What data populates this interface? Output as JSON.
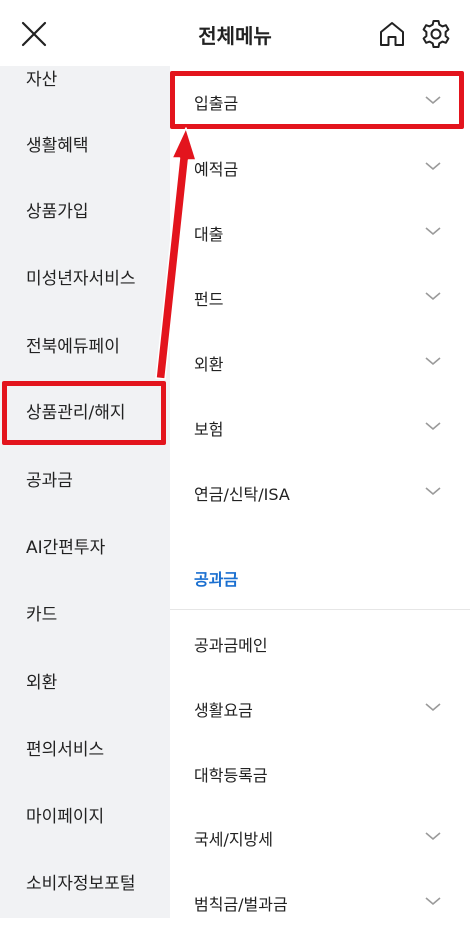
{
  "header": {
    "title": "전체메뉴",
    "close_icon": "close-icon",
    "home_icon": "home-icon",
    "settings_icon": "gear-icon"
  },
  "sidebar": {
    "items": [
      {
        "label": "자산"
      },
      {
        "label": "생활혜택"
      },
      {
        "label": "상품가입"
      },
      {
        "label": "미성년자서비스"
      },
      {
        "label": "전북에듀페이"
      },
      {
        "label": "상품관리/해지"
      },
      {
        "label": "공과금"
      },
      {
        "label": "AI간편투자"
      },
      {
        "label": "카드"
      },
      {
        "label": "외환"
      },
      {
        "label": "편의서비스"
      },
      {
        "label": "마이페이지"
      },
      {
        "label": "소비자정보포털"
      }
    ]
  },
  "menu": {
    "items": [
      {
        "label": "입출금",
        "expandable": true
      },
      {
        "label": "예적금",
        "expandable": true
      },
      {
        "label": "대출",
        "expandable": true
      },
      {
        "label": "펀드",
        "expandable": true
      },
      {
        "label": "외환",
        "expandable": true
      },
      {
        "label": "보험",
        "expandable": true
      },
      {
        "label": "연금/신탁/ISA",
        "expandable": true
      }
    ],
    "section": {
      "title": "공과금",
      "items": [
        {
          "label": "공과금메인",
          "expandable": false
        },
        {
          "label": "생활요금",
          "expandable": true
        },
        {
          "label": "대학등록금",
          "expandable": false
        },
        {
          "label": "국세/지방세",
          "expandable": true
        },
        {
          "label": "범칙금/벌과금",
          "expandable": true
        }
      ]
    }
  },
  "colors": {
    "accent": "#1a6fd0",
    "highlight": "#e3141d",
    "sidebar_bg": "#f1f2f4"
  }
}
